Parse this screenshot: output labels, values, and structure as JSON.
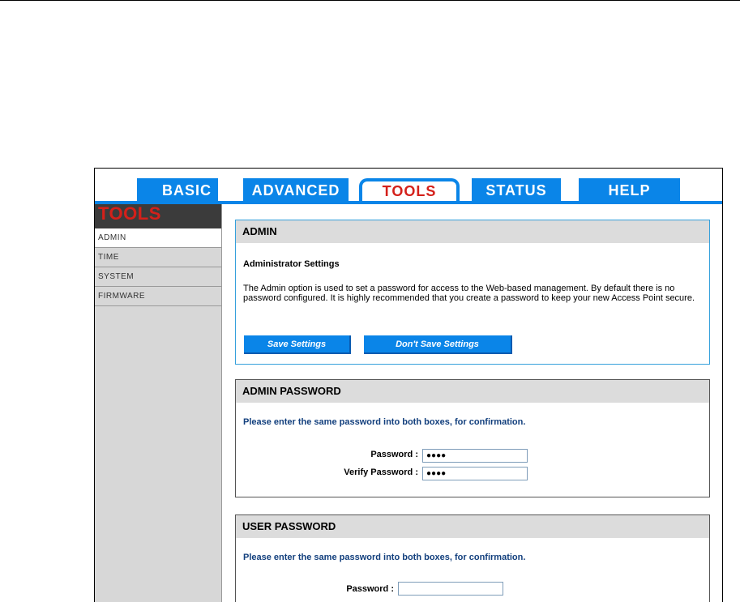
{
  "nav": {
    "tabs": [
      {
        "label": "BASIC"
      },
      {
        "label": "ADVANCED"
      },
      {
        "label": "TOOLS"
      },
      {
        "label": "STATUS"
      },
      {
        "label": "HELP"
      }
    ],
    "active_tab": "TOOLS"
  },
  "sidebar": {
    "title": "TOOLS",
    "items": [
      {
        "label": "ADMIN"
      },
      {
        "label": "TIME"
      },
      {
        "label": "SYSTEM"
      },
      {
        "label": "FIRMWARE"
      }
    ],
    "active_item": "ADMIN"
  },
  "admin": {
    "header": "ADMIN",
    "subheader": "Administrator Settings",
    "description": "The Admin option is used to set a password for access to the Web-based management. By default there is no password configured. It is highly recommended that you create a password to keep your new Access Point secure.",
    "save_label": "Save Settings",
    "dont_save_label": "Don't Save Settings"
  },
  "admin_password": {
    "header": "ADMIN PASSWORD",
    "note": "Please enter the same password into both boxes, for confirmation.",
    "password_label": "Password :",
    "password_value": "●●●●",
    "verify_label": "Verify Password :",
    "verify_value": "●●●●"
  },
  "user_password": {
    "header": "USER PASSWORD",
    "note": "Please enter the same password into both boxes, for confirmation.",
    "password_label": "Password :",
    "password_value": ""
  },
  "colors": {
    "accent_blue": "#0a85e8",
    "active_red": "#d4201a",
    "sidebar_gray": "#d7d7d7",
    "note_blue": "#123f7d"
  }
}
